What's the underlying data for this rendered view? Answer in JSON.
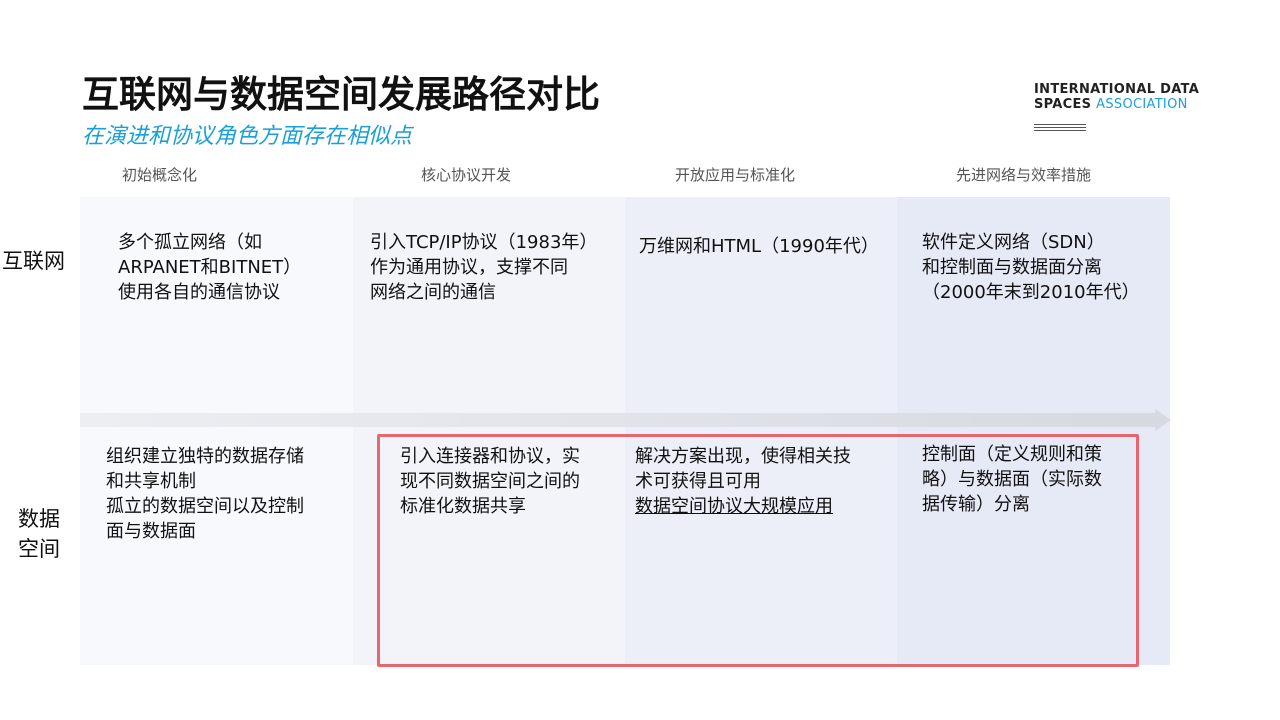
{
  "title": "互联网与数据空间发展路径对比",
  "subtitle": "在演进和协议角色方面存在相似点",
  "logo": {
    "line1": "INTERNATIONAL DATA",
    "line2a": "SPACES",
    "line2b": "ASSOCIATION"
  },
  "phases": [
    "初始概念化",
    "核心协议开发",
    "开放应用与标准化",
    "先进网络与效率措施"
  ],
  "rows": {
    "internet": {
      "label": "互联网",
      "cells": [
        [
          "多个孤立网络（如",
          "ARPANET和BITNET）",
          "使用各自的通信协议"
        ],
        [
          "引入TCP/IP协议（1983年）",
          "作为通用协议，支撑不同",
          "网络之间的通信"
        ],
        [
          "万维网和HTML（1990年代）"
        ],
        [
          "软件定义网络（SDN）",
          "和控制面与数据面分离",
          "（2000年末到2010年代）"
        ]
      ]
    },
    "dataspace": {
      "label_line1": "数据",
      "label_line2": "空间",
      "cells": [
        [
          "组织建立独特的数据存储",
          "和共享机制",
          "孤立的数据空间以及控制",
          "面与数据面"
        ],
        [
          "引入连接器和协议，实",
          "现不同数据空间之间的",
          "标准化数据共享"
        ],
        [
          "解决方案出现，使得相关技",
          "术可获得且可用",
          "数据空间协议大规模应用"
        ],
        [
          "控制面（定义规则和策",
          "略）与数据面（实际数",
          "据传输）分离"
        ]
      ]
    }
  },
  "colors": {
    "accent": "#1a9fd6",
    "highlight": "#e8666e"
  }
}
